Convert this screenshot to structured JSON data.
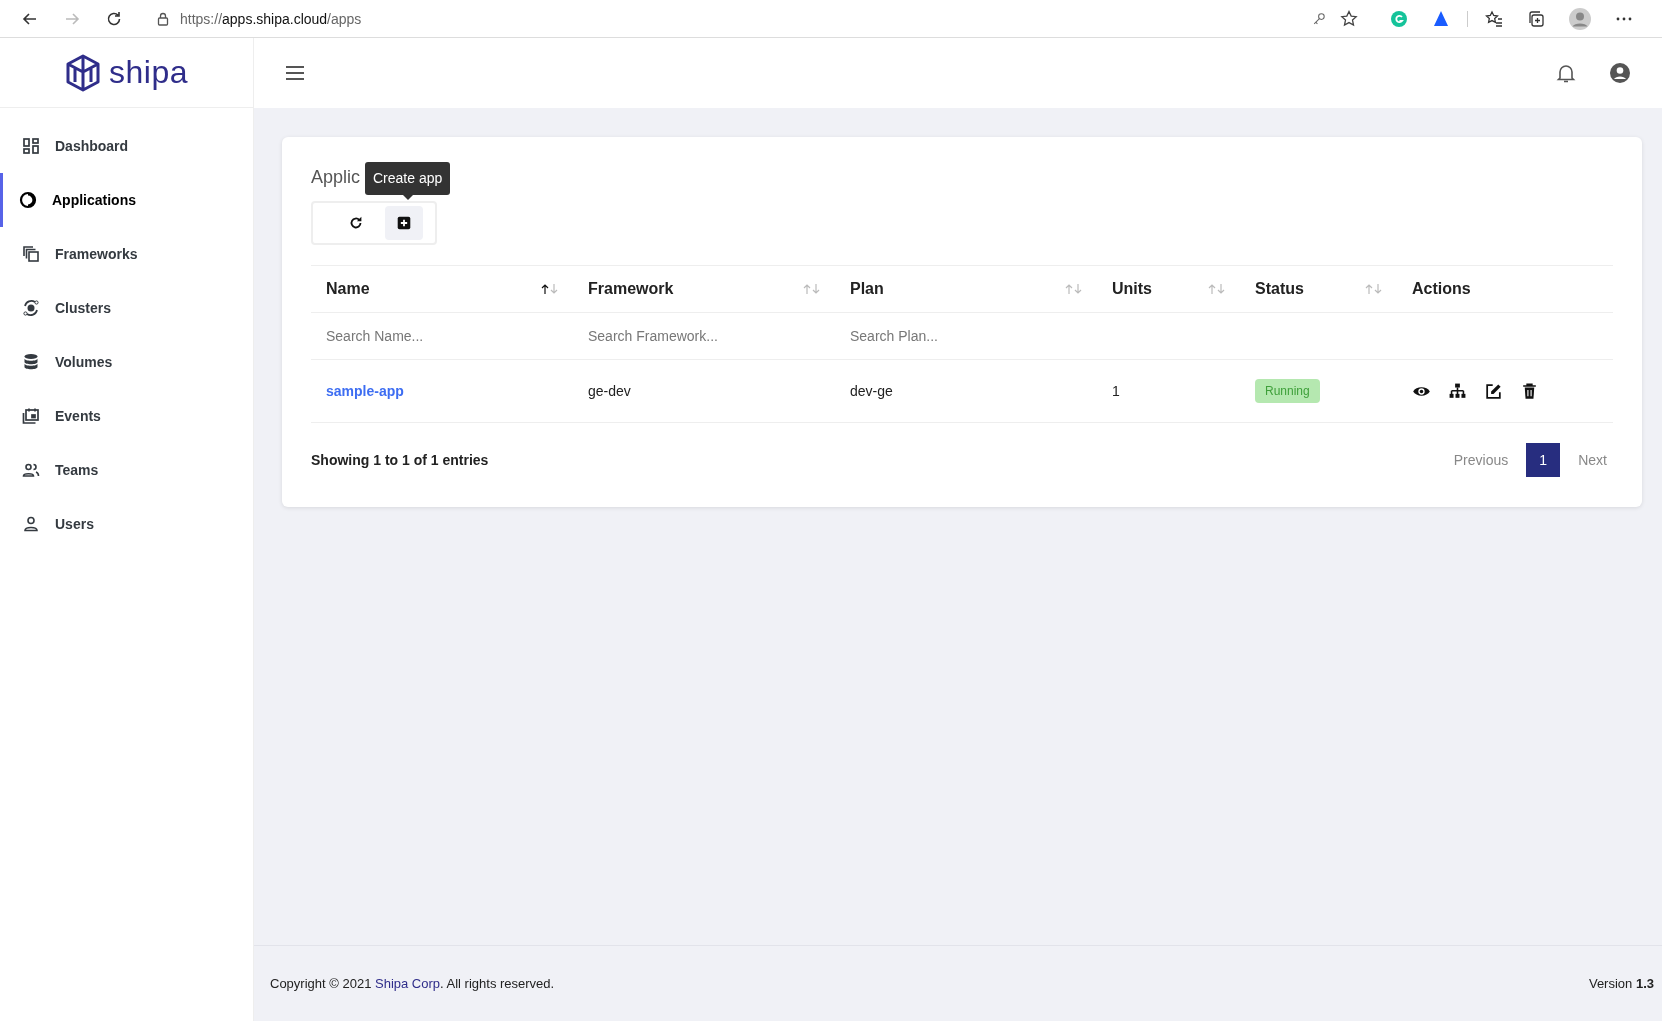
{
  "browser": {
    "url_scheme": "https://",
    "url_host": "apps.shipa.cloud",
    "url_path": "/apps"
  },
  "logo": {
    "text": "shipa"
  },
  "sidebar": {
    "items": [
      {
        "label": "Dashboard",
        "kind": "dashboard",
        "selected": false
      },
      {
        "label": "Applications",
        "kind": "apps",
        "selected": true
      },
      {
        "label": "Frameworks",
        "kind": "frameworks",
        "selected": false
      },
      {
        "label": "Clusters",
        "kind": "clusters",
        "selected": false
      },
      {
        "label": "Volumes",
        "kind": "volumes",
        "selected": false
      },
      {
        "label": "Events",
        "kind": "events",
        "selected": false
      },
      {
        "label": "Teams",
        "kind": "teams",
        "selected": false
      },
      {
        "label": "Users",
        "kind": "users",
        "selected": false
      }
    ]
  },
  "card": {
    "title": "Applic",
    "tooltip": "Create app"
  },
  "table": {
    "columns": [
      {
        "label": "Name",
        "sortable": true,
        "sorted_ascending": true,
        "placeholder": "Search Name..."
      },
      {
        "label": "Framework",
        "sortable": true,
        "sorted_ascending": false,
        "placeholder": "Search Framework..."
      },
      {
        "label": "Plan",
        "sortable": true,
        "sorted_ascending": false,
        "placeholder": "Search Plan..."
      },
      {
        "label": "Units",
        "sortable": true,
        "sorted_ascending": false
      },
      {
        "label": "Status",
        "sortable": true,
        "sorted_ascending": false
      },
      {
        "label": "Actions"
      }
    ],
    "rows": [
      {
        "name": "sample-app",
        "framework": "ge-dev",
        "plan": "dev-ge",
        "units": "1",
        "status": "Running"
      }
    ]
  },
  "summary": "Showing 1 to 1 of 1 entries",
  "pagination": {
    "previous": "Previous",
    "pages": [
      {
        "label": "1",
        "selected": true
      }
    ],
    "next": "Next"
  },
  "footer": {
    "copyright": "Copyright © 2021",
    "company": "Shipa Corp",
    "rights": ". All rights reserved.",
    "version_label": "Version",
    "version": "1.3"
  }
}
